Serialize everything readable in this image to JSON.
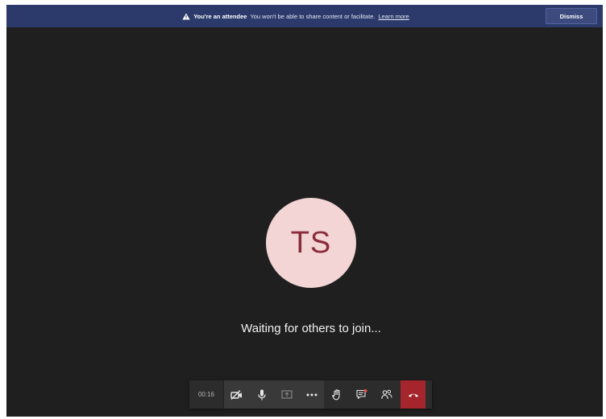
{
  "banner": {
    "icon": "warning-triangle-icon",
    "bold_text": "You're an attendee",
    "text": "You won't be able to share content or facilitate.",
    "link": "Learn more",
    "dismiss_label": "Dismiss"
  },
  "participant": {
    "initials": "TS",
    "avatar_bg": "#f3d5d5",
    "initials_color": "#8a2c3b"
  },
  "status_text": "Waiting for others to join...",
  "toolbar": {
    "timer": "00:16",
    "buttons": [
      {
        "icon": "camera-off-icon"
      },
      {
        "icon": "microphone-icon"
      },
      {
        "icon": "share-screen-icon"
      },
      {
        "icon": "more-options-icon"
      },
      {
        "icon": "raise-hand-icon"
      },
      {
        "icon": "chat-icon"
      },
      {
        "icon": "participants-icon"
      },
      {
        "icon": "hang-up-icon"
      }
    ],
    "hangup_color": "#a4262c"
  }
}
